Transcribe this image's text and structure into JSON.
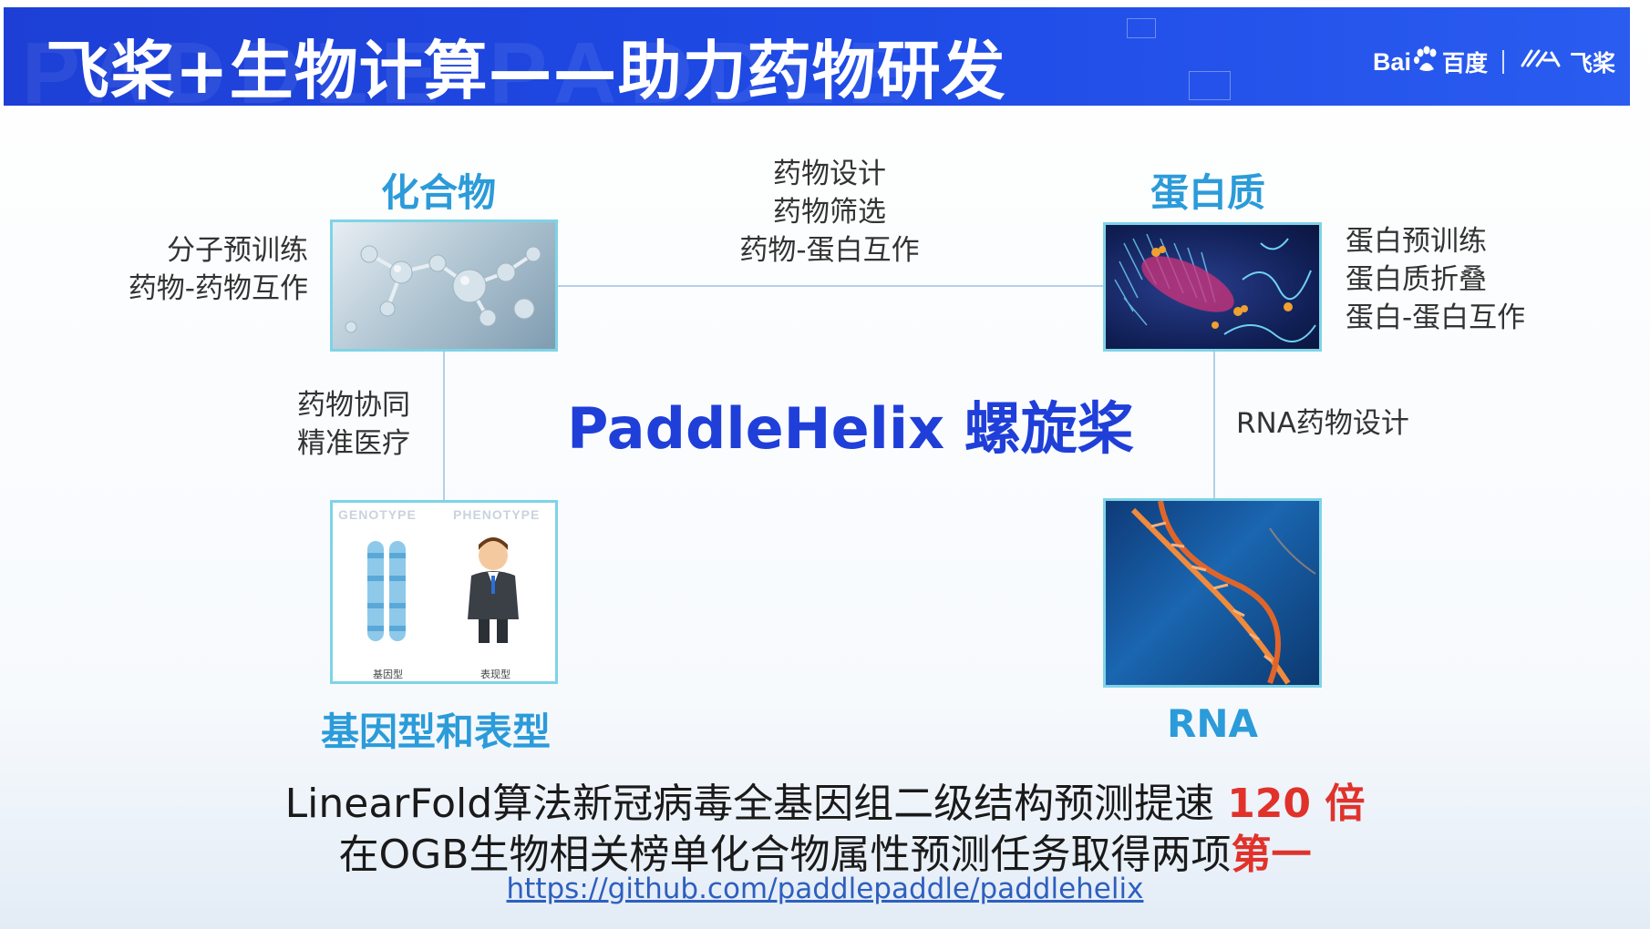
{
  "header": {
    "title": "飞桨+生物计算——助力药物研发",
    "watermark": "PADDLE PADDLE",
    "brand": {
      "baidu": "Bai",
      "baidu_cn": "百度",
      "paddle": "飞桨"
    }
  },
  "center": {
    "title": "PaddleHelix 螺旋桨"
  },
  "nodes": {
    "compound": {
      "title": "化合物",
      "tasks": [
        "分子预训练",
        "药物-药物互作"
      ],
      "image_icon": "molecule-icon"
    },
    "protein": {
      "title": "蛋白质",
      "tasks": [
        "蛋白预训练",
        "蛋白质折叠",
        "蛋白-蛋白互作"
      ],
      "image_icon": "protein-icon"
    },
    "genotype": {
      "title": "基因型和表型",
      "image_labels": {
        "genotype": "GENOTYPE",
        "phenotype": "PHENOTYPE",
        "genotype_cn": "基因型",
        "phenotype_cn": "表现型"
      },
      "image_icon": "chromosome-person-icon"
    },
    "rna": {
      "title": "RNA",
      "image_icon": "rna-helix-icon"
    }
  },
  "edges": {
    "compound_protein": [
      "药物设计",
      "药物筛选",
      "药物-蛋白互作"
    ],
    "compound_genotype": [
      "药物协同",
      "精准医疗"
    ],
    "protein_rna": [
      "RNA药物设计"
    ]
  },
  "highlights": {
    "line1_text": "LinearFold算法新冠病毒全基因组二级结构预测提速",
    "line1_emph": "120 倍",
    "line2_text": "在OGB生物相关榜单化合物属性预测任务取得两项",
    "line2_emph": "第一",
    "url": "https://github.com/paddlepaddle/paddlehelix"
  },
  "colors": {
    "header_bg": "#1f4be6",
    "section_title": "#2b9bd9",
    "center_title": "#1f3fd8",
    "emphasis": "#e0322b",
    "link": "#2e5fbf"
  }
}
